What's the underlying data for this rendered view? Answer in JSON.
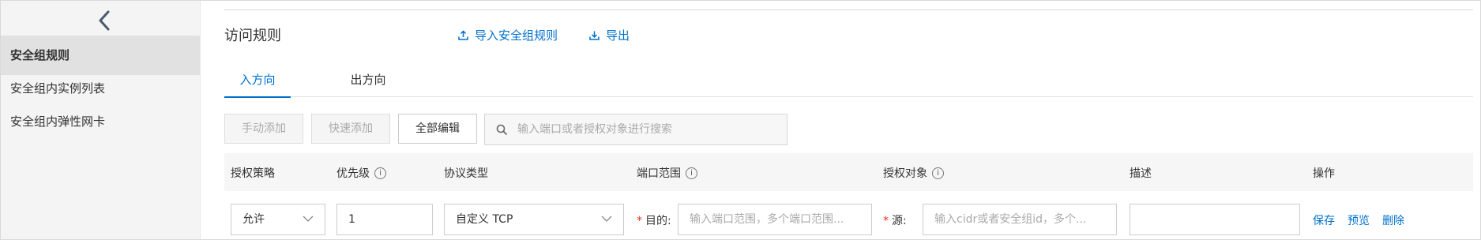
{
  "sidebar": {
    "items": [
      {
        "label": "安全组规则",
        "active": true
      },
      {
        "label": "安全组内实例列表",
        "active": false
      },
      {
        "label": "安全组内弹性网卡",
        "active": false
      }
    ]
  },
  "header": {
    "title": "访问规则",
    "import_label": "导入安全组规则",
    "export_label": "导出"
  },
  "tabs": [
    {
      "label": "入方向",
      "active": true
    },
    {
      "label": "出方向",
      "active": false
    }
  ],
  "toolbar": {
    "manual_add": "手动添加",
    "quick_add": "快速添加",
    "edit_all": "全部编辑",
    "search_placeholder": "输入端口或者授权对象进行搜索"
  },
  "table": {
    "columns": {
      "policy": "授权策略",
      "priority": "优先级",
      "protocol": "协议类型",
      "port_range": "端口范围",
      "auth_object": "授权对象",
      "description": "描述",
      "actions": "操作"
    },
    "row": {
      "policy": "允许",
      "priority": "1",
      "protocol": "自定义 TCP",
      "dest_label": "目的:",
      "port_placeholder": "输入端口范围，多个端口范围...",
      "source_label": "源:",
      "source_placeholder": "输入cidr或者安全组id，多个...",
      "description": "",
      "save": "保存",
      "preview": "预览",
      "delete": "删除"
    }
  },
  "colors": {
    "accent": "#0070cc",
    "required": "#e0301e"
  }
}
